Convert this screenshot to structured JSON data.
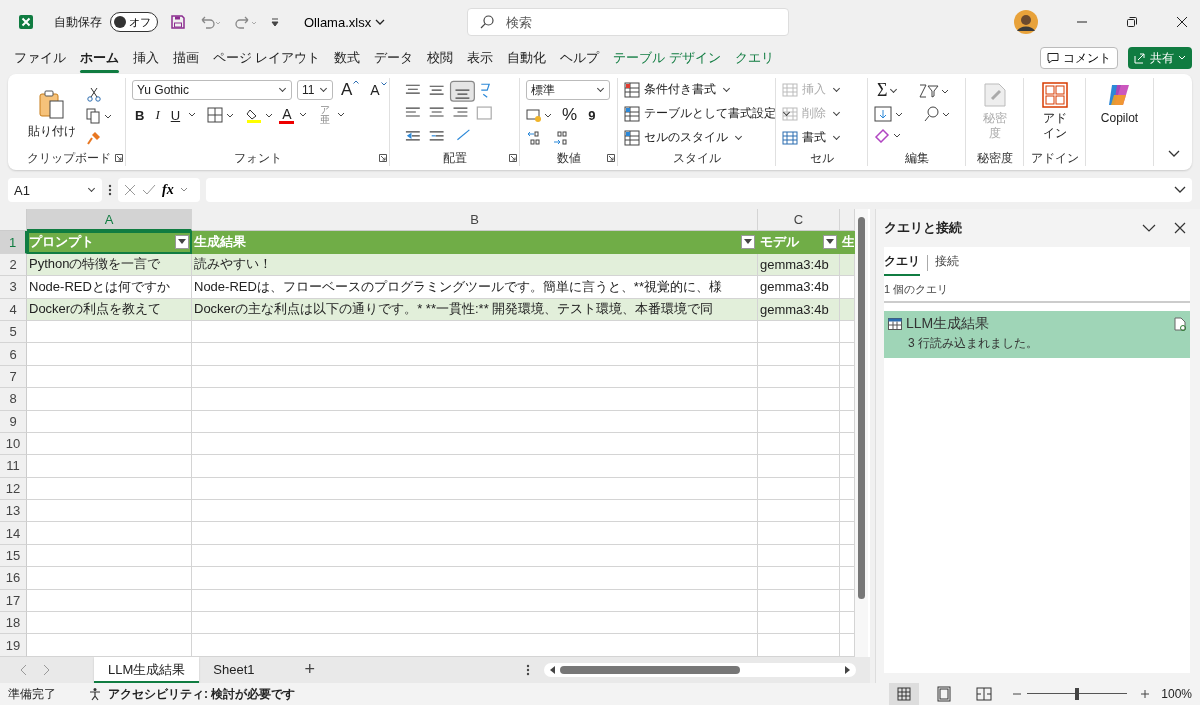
{
  "title_bar": {
    "autosave_label": "自動保存",
    "autosave_toggle": {
      "label": "オフ",
      "on": false
    },
    "file_name": "Ollama.xlsx",
    "search": {
      "placeholder": "検索"
    }
  },
  "menu_tabs": [
    {
      "label": "ファイル",
      "selected": false,
      "kind": "normal"
    },
    {
      "label": "ホーム",
      "selected": true,
      "kind": "normal"
    },
    {
      "label": "挿入",
      "selected": false,
      "kind": "normal"
    },
    {
      "label": "描画",
      "selected": false,
      "kind": "normal"
    },
    {
      "label": "ページ レイアウト",
      "selected": false,
      "kind": "normal"
    },
    {
      "label": "数式",
      "selected": false,
      "kind": "normal"
    },
    {
      "label": "データ",
      "selected": false,
      "kind": "normal"
    },
    {
      "label": "校閲",
      "selected": false,
      "kind": "normal"
    },
    {
      "label": "表示",
      "selected": false,
      "kind": "normal"
    },
    {
      "label": "自動化",
      "selected": false,
      "kind": "normal"
    },
    {
      "label": "ヘルプ",
      "selected": false,
      "kind": "normal"
    },
    {
      "label": "テーブル デザイン",
      "selected": false,
      "kind": "contextual"
    },
    {
      "label": "クエリ",
      "selected": false,
      "kind": "contextual"
    }
  ],
  "comment_button": "コメント",
  "share_button": "共有",
  "ribbon": {
    "clipboard": {
      "paste": "貼り付け",
      "label": "クリップボード"
    },
    "font": {
      "name": "Yu Gothic",
      "size": "11",
      "grow": "A",
      "shrink": "A",
      "bold": "B",
      "italic": "I",
      "underline": "U",
      "font_color": "A",
      "phonetic": "ア亜",
      "label": "フォント"
    },
    "alignment": {
      "label": "配置"
    },
    "number": {
      "format": "標準",
      "percent": "%",
      "comma": "9",
      "label": "数値"
    },
    "styles": {
      "items": [
        "条件付き書式",
        "テーブルとして書式設定",
        "セルのスタイル"
      ],
      "label": "スタイル"
    },
    "cells": {
      "items": [
        {
          "label": "挿入",
          "disabled": true
        },
        {
          "label": "削除",
          "disabled": true
        },
        {
          "label": "書式",
          "disabled": false
        }
      ],
      "label": "セル"
    },
    "editing": {
      "sum": "Σ",
      "label": "編集"
    },
    "sensitivity": {
      "button": "秘密度",
      "disabled": true,
      "label": "秘密度"
    },
    "addins": {
      "button": "アドイン",
      "label": "アドイン"
    },
    "copilot": {
      "button": "Copilot"
    }
  },
  "formula_bar": {
    "name_box": "A1",
    "fx": "fx"
  },
  "sheet": {
    "columns": [
      {
        "label": "A",
        "selected": true
      },
      {
        "label": "B",
        "selected": false
      },
      {
        "label": "C",
        "selected": false
      }
    ],
    "row_numbers": [
      {
        "label": "1",
        "selected": true
      },
      {
        "label": "2",
        "selected": false
      },
      {
        "label": "3",
        "selected": false
      },
      {
        "label": "4",
        "selected": false
      },
      {
        "label": "5",
        "selected": false
      },
      {
        "label": "6",
        "selected": false
      },
      {
        "label": "7",
        "selected": false
      },
      {
        "label": "8",
        "selected": false
      },
      {
        "label": "9",
        "selected": false
      },
      {
        "label": "10",
        "selected": false
      },
      {
        "label": "11",
        "selected": false
      },
      {
        "label": "12",
        "selected": false
      },
      {
        "label": "13",
        "selected": false
      },
      {
        "label": "14",
        "selected": false
      },
      {
        "label": "15",
        "selected": false
      },
      {
        "label": "16",
        "selected": false
      },
      {
        "label": "17",
        "selected": false
      },
      {
        "label": "18",
        "selected": false
      },
      {
        "label": "19",
        "selected": false
      }
    ],
    "table": {
      "headers": [
        "プロンプト",
        "生成結果",
        "モデル",
        "生"
      ],
      "rows": [
        [
          "Pythonの特徴を一言で",
          "読みやすい！",
          "gemma3:4b"
        ],
        [
          "Node-REDとは何ですか",
          "Node-REDは、フローベースのプログラミングツールです。簡単に言うと、**視覚的に、様",
          "gemma3:4b"
        ],
        [
          "Dockerの利点を教えて",
          "Dockerの主な利点は以下の通りです。*   **一貫性:** 開発環境、テスト環境、本番環境で同",
          "gemma3:4b"
        ]
      ]
    }
  },
  "queries_panel": {
    "title": "クエリと接続",
    "tabs": [
      {
        "label": "クエリ",
        "selected": true
      },
      {
        "label": "接続",
        "selected": false
      }
    ],
    "count": "1 個のクエリ",
    "queries": [
      {
        "name": "LLM生成結果",
        "status": "3 行読み込まれました。",
        "selected": true
      }
    ]
  },
  "sheet_tabs": [
    {
      "label": "LLM生成結果",
      "selected": true
    },
    {
      "label": "Sheet1",
      "selected": false
    }
  ],
  "add_sheet": "+",
  "status_bar": {
    "ready": "準備完了",
    "accessibility": "アクセシビリティ: 検討が必要です",
    "zoom": {
      "level": 0.5,
      "reading": "100%"
    }
  }
}
